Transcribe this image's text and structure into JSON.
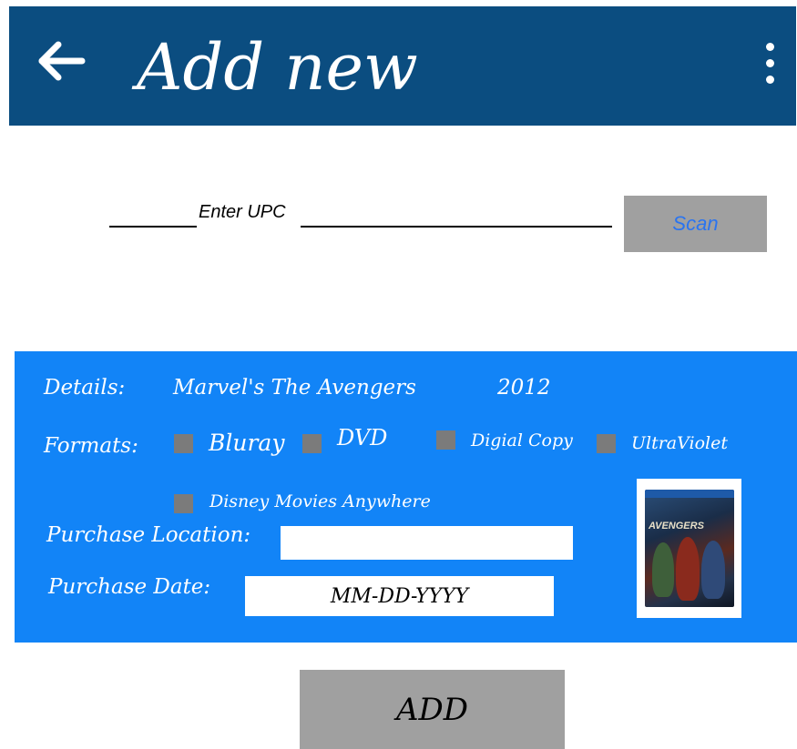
{
  "app_bar": {
    "title": "Add new",
    "back_icon": "arrow-left-icon",
    "more_icon": "more-vertical-icon",
    "background_color": "#0b4d80"
  },
  "upc": {
    "placeholder": "Enter UPC",
    "value": "",
    "scan_label": "Scan"
  },
  "details": {
    "label": "Details:",
    "movie_title": "Marvel's The Avengers",
    "year": "2012",
    "formats_label": "Formats:",
    "formats": [
      {
        "label": "Bluray",
        "checked": false
      },
      {
        "label": "DVD",
        "checked": false
      },
      {
        "label": "Digial Copy",
        "checked": false
      },
      {
        "label": "UltraViolet",
        "checked": false
      },
      {
        "label": "Disney Movies Anywhere",
        "checked": false
      }
    ],
    "purchase_location_label": "Purchase Location:",
    "purchase_location_value": "",
    "purchase_date_label": "Purchase Date:",
    "purchase_date_value": "MM-DD-YYYY",
    "background_color": "#1284f7"
  },
  "cover": {
    "cover_title": "AVENGERS"
  },
  "add_button_label": "ADD",
  "colors": {
    "button_gray": "#a0a0a0",
    "checkbox_gray": "#7b7b7b",
    "scan_text": "#2a74f0"
  }
}
